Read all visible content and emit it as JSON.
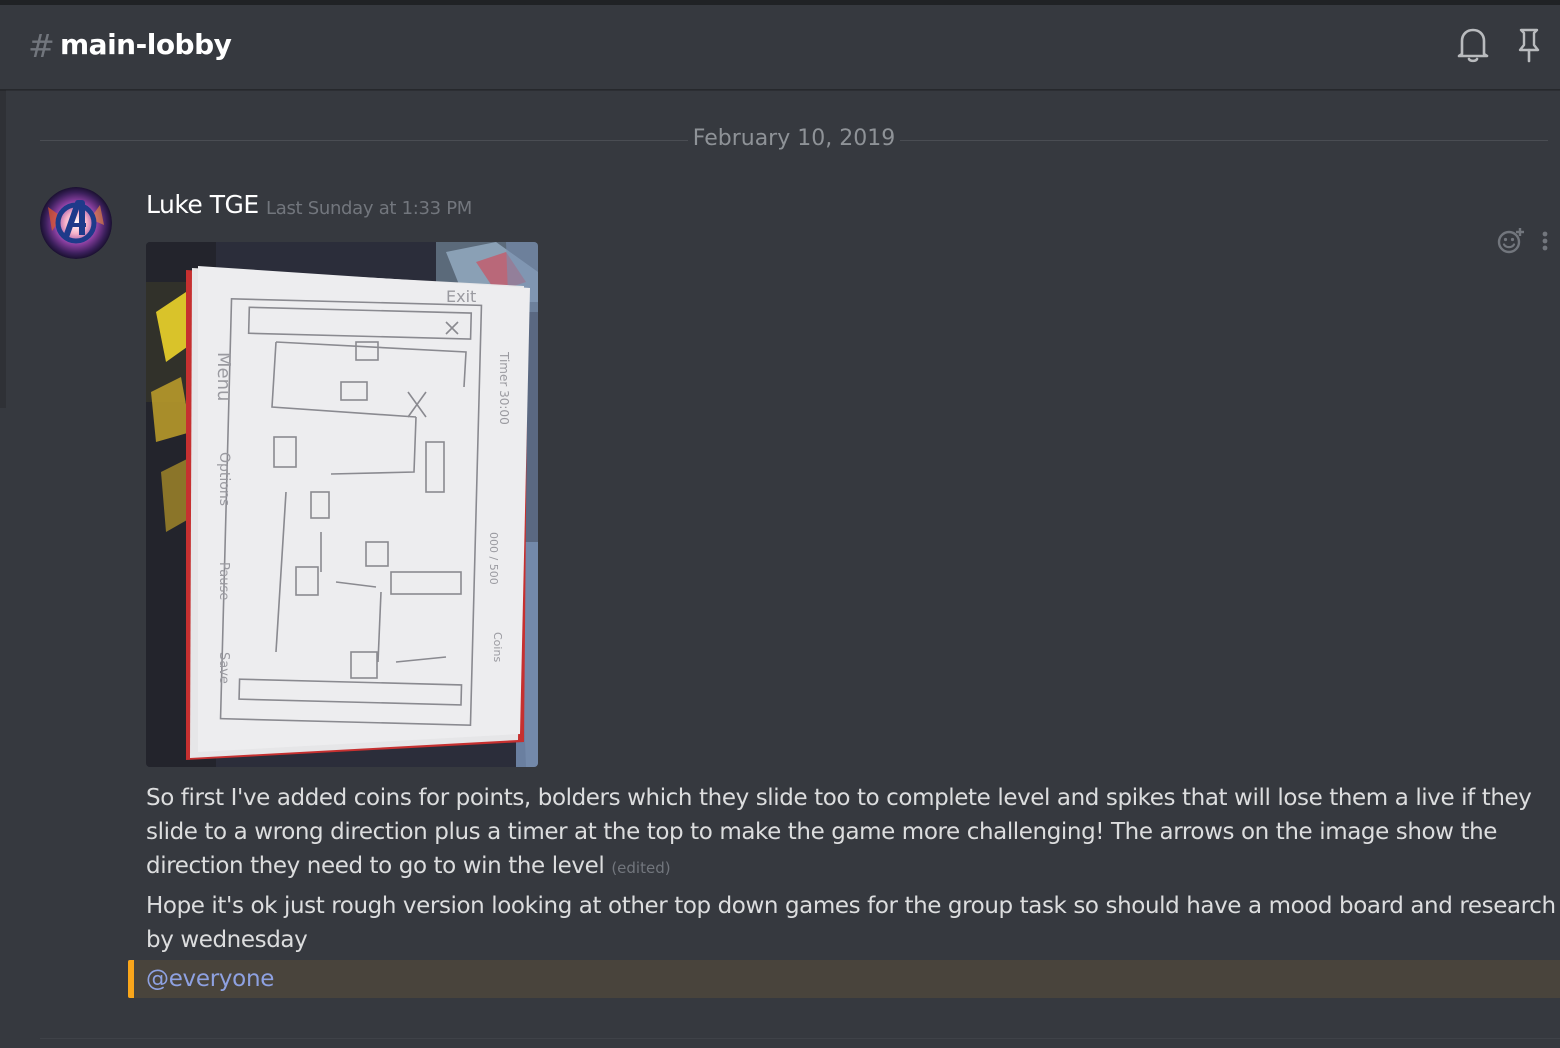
{
  "header": {
    "hash": "#",
    "channel_name": "main-lobby",
    "icons": [
      "bell-icon",
      "pin-icon"
    ]
  },
  "divider": {
    "date": "February 10, 2019"
  },
  "message": {
    "author": "Luke TGE",
    "timestamp": "Last Sunday at 1:33 PM",
    "avatar_icon": "avengers-logo-avatar",
    "attachment_icon": "hand-drawn-level-sketch-image",
    "text_1": "So first I've added coins for points, bolders which they slide too to complete level and spikes that will lose them a live if they slide to a wrong direction plus a timer at the top to make the game more challenging! The arrows on the image show the direction they need to go to win the level",
    "edited_label": "(edited)",
    "text_2": "Hope it's ok just rough version looking at other top down games for the group task so should have a mood board and research by wednesday",
    "mention": "@everyone",
    "actions": [
      "add-reaction-icon",
      "more-options-icon"
    ]
  },
  "colors": {
    "background": "#36393f",
    "text": "#dcddde",
    "muted": "#72767d",
    "mention_highlight": "#49443c",
    "mention_bar": "#faa61a",
    "mention_text": "#8ea1e1"
  }
}
